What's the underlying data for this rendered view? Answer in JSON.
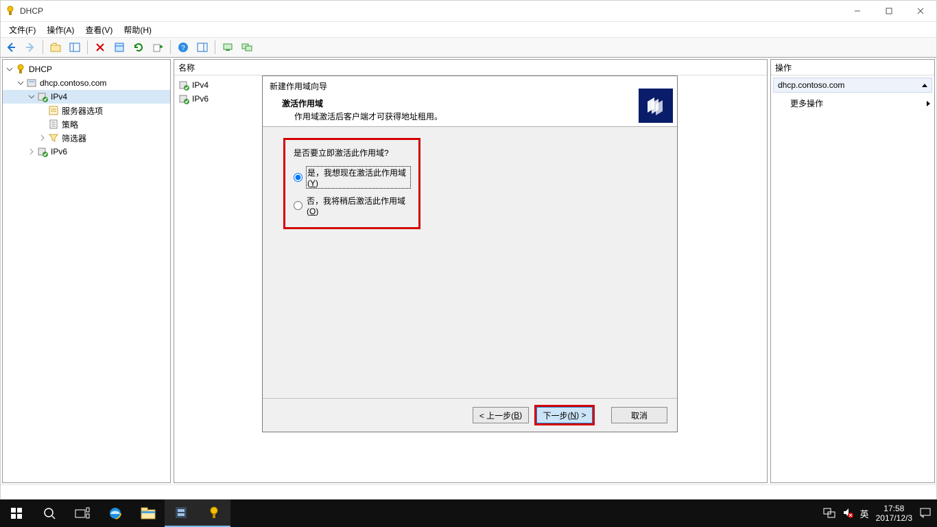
{
  "window": {
    "title": "DHCP",
    "menu": {
      "file": "文件(F)",
      "action": "操作(A)",
      "view": "查看(V)",
      "help": "帮助(H)"
    }
  },
  "tree": {
    "root": "DHCP",
    "server": "dhcp.contoso.com",
    "ipv4": "IPv4",
    "ipv4_children": {
      "server_options": "服务器选项",
      "policies": "策略",
      "filters": "筛选器"
    },
    "ipv6": "IPv6"
  },
  "center": {
    "header": "名称",
    "items": {
      "ipv4": "IPv4",
      "ipv6": "IPv6"
    }
  },
  "wizard": {
    "title": "新建作用域向导",
    "section_title": "激活作用域",
    "section_desc": "作用域激活后客户端才可获得地址租用。",
    "question": "是否要立即激活此作用域?",
    "option_yes_pre": "是，我想现在激活此作用域(",
    "option_yes_key": "Y",
    "option_yes_post": ")",
    "option_no_pre": "否，我将稍后激活此作用域(",
    "option_no_key": "O",
    "option_no_post": ")",
    "back_pre": "< 上一步(",
    "back_key": "B",
    "back_post": ")",
    "next_pre": "下一步(",
    "next_key": "N",
    "next_post": ") >",
    "cancel": "取消"
  },
  "actions": {
    "header": "操作",
    "group": "dhcp.contoso.com",
    "more": "更多操作"
  },
  "taskbar": {
    "ime": "英",
    "time": "17:58",
    "date": "2017/12/3"
  }
}
